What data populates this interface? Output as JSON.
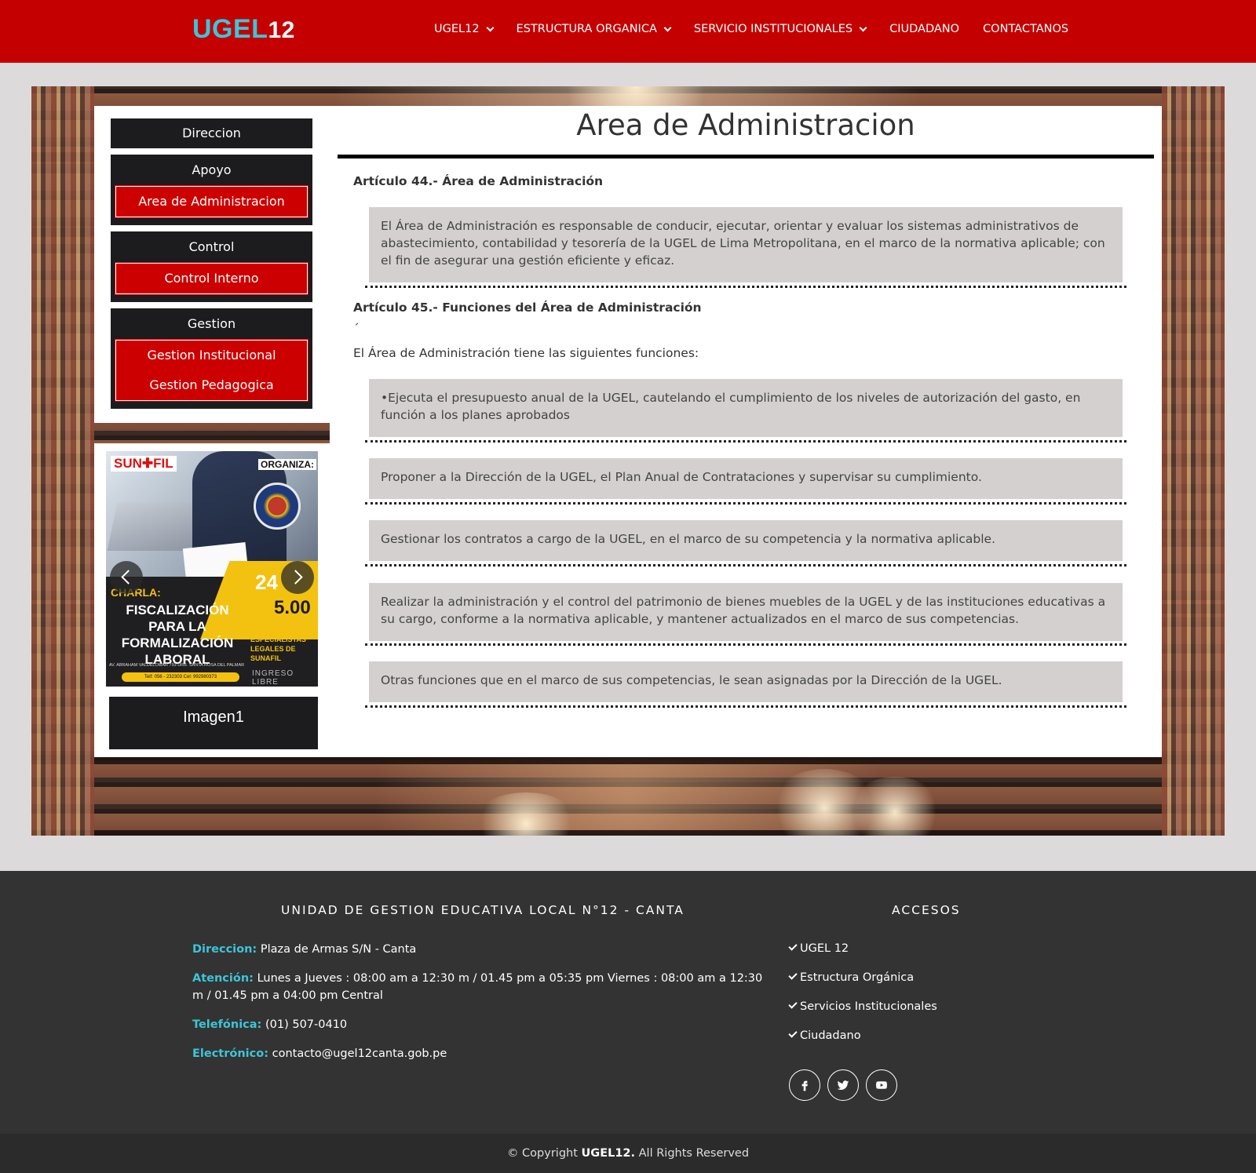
{
  "header": {
    "logo_part1": "UGEL",
    "logo_part2": "12",
    "nav": [
      {
        "label": "UGEL12",
        "has_dropdown": true
      },
      {
        "label": "ESTRUCTURA ORGANICA",
        "has_dropdown": true
      },
      {
        "label": "SERVICIO INSTITUCIONALES",
        "has_dropdown": true
      },
      {
        "label": "CIUDADANO",
        "has_dropdown": false
      },
      {
        "label": "CONTACTANOS",
        "has_dropdown": false
      }
    ]
  },
  "sidebar": {
    "direccion": "Direccion",
    "groups": [
      {
        "title": "Apoyo",
        "items": [
          "Area de Administracion"
        ]
      },
      {
        "title": "Control",
        "items": [
          "Control Interno"
        ]
      },
      {
        "title": "Gestion",
        "items": [
          "Gestion Institucional",
          "Gestion Pedagogica"
        ]
      }
    ]
  },
  "slider": {
    "caption": "Imagen1",
    "poster": {
      "brand": "SUN✚FIL",
      "organiza": "ORGANIZA:",
      "charla": "CHARLA:",
      "headline": "FISCALIZACIÓN PARA LA FORMALIZACIÓN LABORAL",
      "day": "24",
      "hour": "5.00",
      "expositor": "EXPOSITOR: ESPECIALISTAS LEGALES DE SUNAFIL",
      "ingreso": "INGRESO LIBRE",
      "address": "AV. ABRAHAM VALDELOMAR 793 URB. SANTA ROSA DEL PALMAR",
      "contact": "Telf: 056 - 232303  Cel: 992980373"
    }
  },
  "main": {
    "title": "Area de Administracion",
    "art44_heading": "Artículo 44.- Área de Administración",
    "art44_text": "El Área de Administración es responsable de conducir, ejecutar, orientar y evaluar los sistemas administrativos de abastecimiento, contabilidad y tesorería de la UGEL de Lima Metropolitana, en el marco de la normativa aplicable; con el fin de asegurar una gestión eficiente y eficaz.",
    "art45_heading": "Artículo 45.- Funciones del Área de Administración",
    "stray_mark": "´",
    "functions_intro": "El Área de Administración tiene las siguientes funciones:",
    "functions": [
      "•Ejecuta el presupuesto anual de la UGEL, cautelando el cumplimiento de los niveles de autorización del gasto, en función a los planes aprobados",
      "Proponer a la Dirección de la UGEL, el Plan Anual de Contrataciones y supervisar su cumplimiento.",
      "Gestionar los contratos a cargo de la UGEL, en el marco de su competencia y la normativa aplicable.",
      "Realizar la administración y el control del patrimonio de bienes muebles de la UGEL y de las instituciones educativas a su cargo, conforme a la normativa aplicable, y mantener actualizados en el marco de sus competencias.",
      "Otras funciones que en el marco de sus competencias, le sean asignadas por la Dirección de la UGEL."
    ]
  },
  "footer": {
    "left_title": "UNIDAD DE GESTION EDUCATIVA LOCAL N°12 - CANTA",
    "direccion_label": "Direccion:",
    "direccion_value": "Plaza de Armas S/N - Canta",
    "atencion_label": "Atención:",
    "atencion_value": "Lunes a Jueves : 08:00 am a 12:30 m / 01.45 pm a 05:35 pm Viernes : 08:00 am a 12:30 m / 01.45 pm a 04:00 pm Central",
    "telefonica_label": "Telefónica:",
    "telefonica_value": "(01) 507-0410",
    "electronico_label": "Electrónico:",
    "electronico_value": "contacto@ugel12canta.gob.pe",
    "right_title": "ACCESOS",
    "links": [
      "UGEL 12",
      "Estructura Orgánica",
      "Servicios Institucionales",
      "Ciudadano"
    ],
    "social": [
      "facebook-icon",
      "twitter-icon",
      "youtube-icon"
    ],
    "copyright_prefix": "© Copyright",
    "copyright_brand": "UGEL12.",
    "copyright_suffix": "All Rights Reserved"
  },
  "colors": {
    "header_red": "#c50000",
    "accent_cyan": "#3ec4d8",
    "sidebar_dark": "#1c1c1e",
    "sidebar_red": "#cc0000",
    "footer_dark": "#333333"
  }
}
